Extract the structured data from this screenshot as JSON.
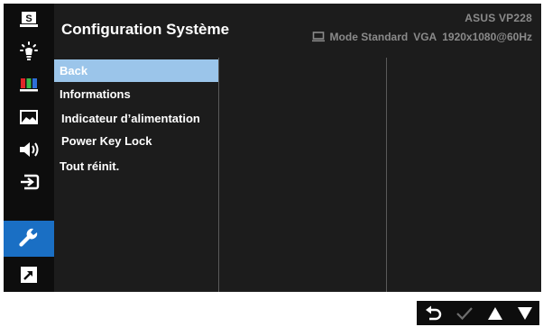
{
  "header": {
    "title": "Configuration Système",
    "model": "ASUS  VP228",
    "mode": "Mode Standard",
    "input": "VGA",
    "resolution": "1920x1080@60Hz"
  },
  "sidebar": {
    "items": [
      {
        "icon": "splendid-s-icon"
      },
      {
        "icon": "brightness-icon"
      },
      {
        "icon": "color-bars-icon"
      },
      {
        "icon": "image-icon"
      },
      {
        "icon": "speaker-icon"
      },
      {
        "icon": "input-select-icon"
      },
      {
        "icon": "wrench-icon",
        "active": true
      },
      {
        "icon": "shortcut-icon"
      }
    ]
  },
  "menu": {
    "items": [
      {
        "label": "Back",
        "selected": true
      },
      {
        "label": "Informations"
      },
      {
        "label": "Indicateur d’alimentation"
      },
      {
        "label": "Power Key Lock"
      },
      {
        "label": "Tout réinit."
      }
    ]
  },
  "colors": {
    "accent": "#1a6fc4",
    "selection": "#9bc5ea",
    "background": "#1c1c1c",
    "sidebar": "#0d0d0d"
  },
  "controls": [
    "back-icon",
    "confirm-check-icon",
    "up-arrow-icon",
    "down-arrow-icon"
  ]
}
